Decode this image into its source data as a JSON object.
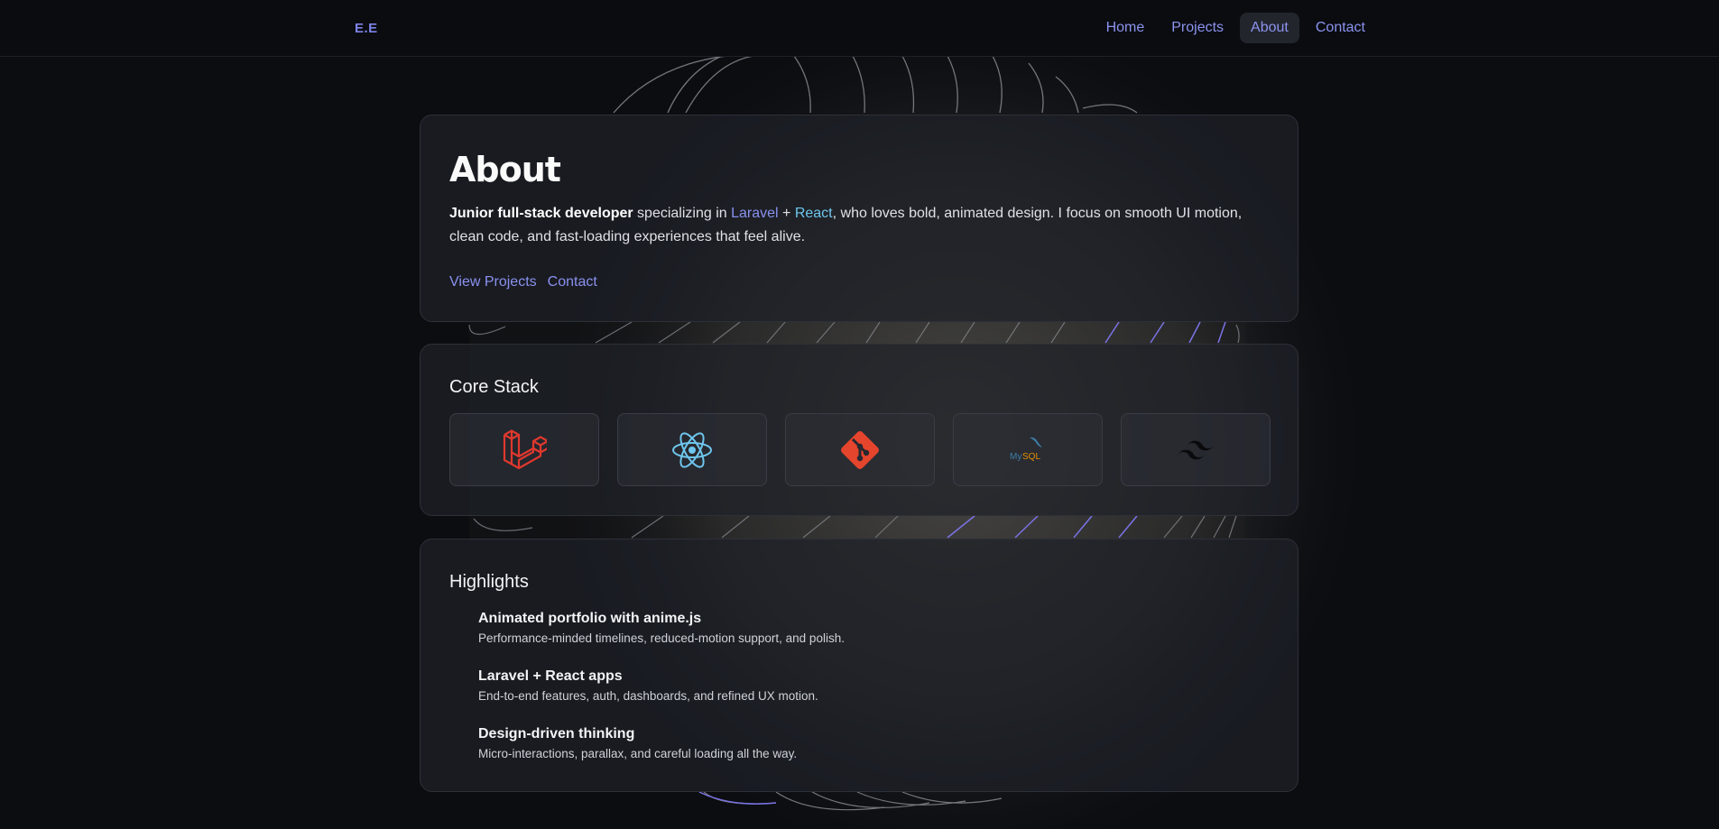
{
  "nav": {
    "logo": "E.E",
    "links": [
      {
        "label": "Home"
      },
      {
        "label": "Projects"
      },
      {
        "label": "About",
        "active": true
      },
      {
        "label": "Contact"
      }
    ]
  },
  "about": {
    "title": "About",
    "intro_bold": "Junior full-stack developer",
    "intro_mid": " specializing in ",
    "tech1": "Laravel",
    "plus": " + ",
    "tech2": "React",
    "intro_rest": ", who loves bold, animated design. I focus on smooth UI motion, clean code, and fast-loading experiences that feel alive.",
    "cta_projects": "View Projects",
    "cta_contact": "Contact"
  },
  "stack": {
    "title": "Core Stack",
    "items": [
      {
        "icon": "laravel-icon"
      },
      {
        "icon": "react-icon"
      },
      {
        "icon": "git-icon"
      },
      {
        "icon": "mysql-icon",
        "text": "MySQL"
      },
      {
        "icon": "tailwind-icon"
      }
    ]
  },
  "highlights": {
    "title": "Highlights",
    "items": [
      {
        "title": "Animated portfolio with anime.js",
        "desc": "Performance-minded timelines, reduced-motion support, and polish."
      },
      {
        "title": "Laravel + React apps",
        "desc": "End-to-end features, auth, dashboards, and refined UX motion."
      },
      {
        "title": "Design-driven thinking",
        "desc": "Micro-interactions, parallax, and careful loading all the way."
      }
    ]
  },
  "colors": {
    "background": "#0b0d11",
    "accent": "#8a91ee",
    "react": "#6ec6ee",
    "laravel": "#e0382f",
    "git": "#e4452c",
    "mysql_blue": "#3f7ea8",
    "mysql_orange": "#e48e00"
  }
}
